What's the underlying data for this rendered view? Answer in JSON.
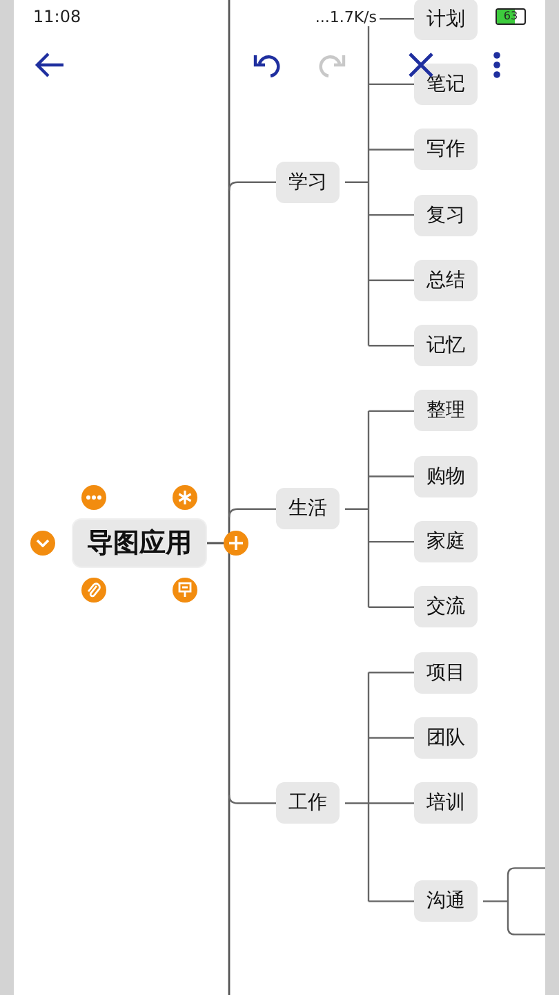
{
  "status_bar": {
    "time": "11:08",
    "net_speed": "...1.7K/s",
    "battery": "63"
  },
  "toolbar": [
    {
      "kind": "back",
      "disabled": false
    },
    {
      "kind": "undo",
      "disabled": false
    },
    {
      "kind": "redo",
      "disabled": true
    },
    {
      "kind": "close",
      "disabled": false
    },
    {
      "kind": "more",
      "disabled": false
    }
  ],
  "mind_map": {
    "root": {
      "label": "导图应用",
      "selected": true,
      "actions": [
        {
          "kind": "more"
        },
        {
          "kind": "asterisk"
        },
        {
          "kind": "collapse"
        },
        {
          "kind": "add"
        },
        {
          "kind": "attach"
        },
        {
          "kind": "sign"
        }
      ]
    },
    "branches": [
      {
        "label": "学习",
        "children": [
          {
            "label": "计划",
            "expanded": false
          },
          {
            "label": "笔记",
            "expanded": false
          },
          {
            "label": "写作",
            "expanded": false
          },
          {
            "label": "复习",
            "expanded": false
          },
          {
            "label": "总结",
            "expanded": false
          },
          {
            "label": "记忆",
            "expanded": false
          }
        ]
      },
      {
        "label": "生活",
        "children": [
          {
            "label": "整理",
            "expanded": false
          },
          {
            "label": "购物",
            "expanded": false
          },
          {
            "label": "家庭",
            "expanded": false
          },
          {
            "label": "交流",
            "expanded": false
          }
        ]
      },
      {
        "label": "工作",
        "children": [
          {
            "label": "项目",
            "expanded": false
          },
          {
            "label": "团队",
            "expanded": false
          },
          {
            "label": "培训",
            "expanded": false
          },
          {
            "label": "沟通",
            "expanded": true
          }
        ]
      }
    ]
  }
}
